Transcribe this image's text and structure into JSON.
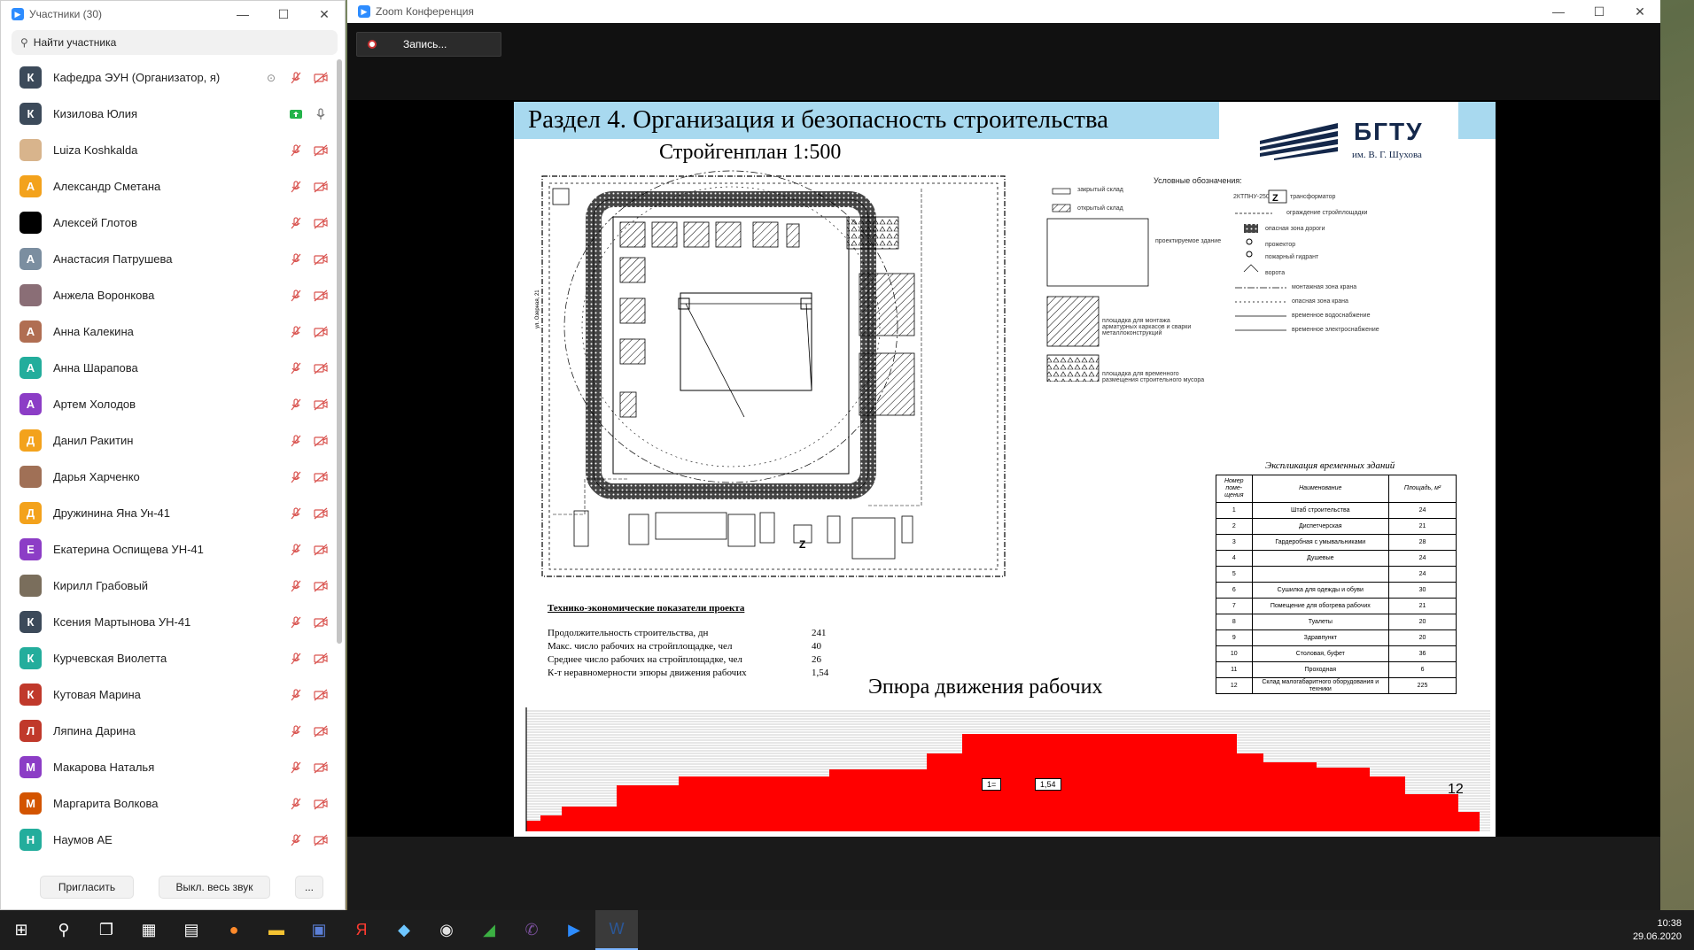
{
  "participants_window": {
    "title": "Участники (30)",
    "search_placeholder": "Найти участника",
    "participants": [
      {
        "name": "Кафедра ЭУН (Организатор, я)",
        "initial": "К",
        "color": "#3c4a5a",
        "host": true
      },
      {
        "name": "Кизилова Юлия",
        "initial": "К",
        "color": "#3c4a5a",
        "sharing": true
      },
      {
        "name": "Luiza Koshkalda",
        "initial": "",
        "color": "#d8b48c",
        "photo": true
      },
      {
        "name": "Александр Сметана",
        "initial": "А",
        "color": "#f3a21c"
      },
      {
        "name": "Алексей Глотов",
        "initial": "",
        "color": "#000000",
        "photo": true
      },
      {
        "name": "Анастасия Патрушева",
        "initial": "А",
        "color": "#7b8ea0"
      },
      {
        "name": "Анжела Воронкова",
        "initial": "",
        "color": "#8a6e76",
        "photo": true
      },
      {
        "name": "Анна Калекина",
        "initial": "А",
        "color": "#b06e52"
      },
      {
        "name": "Анна Шарапова",
        "initial": "А",
        "color": "#23ad9c"
      },
      {
        "name": "Артем Холодов",
        "initial": "А",
        "color": "#8c3dc6"
      },
      {
        "name": "Данил Ракитин",
        "initial": "Д",
        "color": "#f3a21c"
      },
      {
        "name": "Дарья Харченко",
        "initial": "",
        "color": "#a07056",
        "photo": true
      },
      {
        "name": "Дружинина Яна Ун-41",
        "initial": "Д",
        "color": "#f3a21c"
      },
      {
        "name": "Екатерина Оспищева УН-41",
        "initial": "Е",
        "color": "#8c3dc6"
      },
      {
        "name": "Кирилл Грабовый",
        "initial": "",
        "color": "#7a6e5c",
        "photo": true
      },
      {
        "name": "Ксения Мартынова УН-41",
        "initial": "К",
        "color": "#3c4a5a"
      },
      {
        "name": "Курчевская Виолетта",
        "initial": "К",
        "color": "#23ad9c"
      },
      {
        "name": "Кутовая Марина",
        "initial": "К",
        "color": "#c0392b"
      },
      {
        "name": "Ляпина Дарина",
        "initial": "Л",
        "color": "#c0392b"
      },
      {
        "name": "Макарова Наталья",
        "initial": "М",
        "color": "#8c3dc6"
      },
      {
        "name": "Маргарита Волкова",
        "initial": "М",
        "color": "#d35400"
      },
      {
        "name": "Наумов АЕ",
        "initial": "Н",
        "color": "#23ad9c"
      }
    ],
    "footer": {
      "invite": "Пригласить",
      "mute_all": "Выкл. весь звук",
      "more": "..."
    }
  },
  "zoom_window": {
    "title": "Zoom Конференция",
    "record_label": "Запись..."
  },
  "slide": {
    "header_title": "Раздел 4. Организация и безопасность строительства",
    "logo_main": "БГТУ",
    "logo_sub": "им. В. Г. Шухова",
    "plan_title": "Стройгенплан 1:500",
    "legend_title": "Условные обозначения:",
    "legend_items": {
      "closed_storage": "закрытый склад",
      "open_storage": "открытый склад",
      "designed_building": "проектируемое здание",
      "assembly_area": "площадка для монтажа арматурных каркасов и сварки металлоконструкций",
      "waste_area": "площадка для временного размещения строительного мусора",
      "transformer_label": "2КТПНУ-250",
      "transformer": "трансформатор",
      "fence": "ограждение стройплощадки",
      "danger_road": "опасная зона дороги",
      "projector": "прожектор",
      "hydrant": "пожарный гидрант",
      "gates": "ворота",
      "crane_mount": "монтажная зона крана",
      "crane_danger": "опасная зона крана",
      "temp_water": "временное водоснабжение",
      "temp_power": "временное электроснабжение"
    },
    "tep": {
      "title": "Технико-экономические показатели проекта",
      "rows": [
        {
          "label": "Продолжительность строительства, дн",
          "value": "241"
        },
        {
          "label": "Макс. число рабочих на стройплощадке, чел",
          "value": "40"
        },
        {
          "label": "Среднее число рабочих на стройплощадке, чел",
          "value": "26"
        },
        {
          "label": "К-т неравномерности эпюры движения рабочих",
          "value": "1,54"
        }
      ]
    },
    "explication": {
      "title": "Экспликация временных зданий",
      "headers": [
        "Номер поме-щения",
        "Наименование",
        "Площадь, м²"
      ],
      "rows": [
        [
          "1",
          "Штаб строительства",
          "24"
        ],
        [
          "2",
          "Диспетчерская",
          "21"
        ],
        [
          "3",
          "Гардеробная с умывальниками",
          "28"
        ],
        [
          "4",
          "Душевые",
          "24"
        ],
        [
          "5",
          "",
          "24"
        ],
        [
          "6",
          "Сушилка для одежды и обуви",
          "30"
        ],
        [
          "7",
          "Помещение для обогрева рабочих",
          "21"
        ],
        [
          "8",
          "Туалеты",
          "20"
        ],
        [
          "9",
          "Здравпункт",
          "20"
        ],
        [
          "10",
          "Столовая, буфет",
          "36"
        ],
        [
          "11",
          "Проходная",
          "6"
        ],
        [
          "12",
          "Склад малогабаритного оборудования и техники",
          "225"
        ]
      ]
    },
    "epure_title": "Эпюра движения рабочих",
    "epure_label_a": "1=",
    "epure_label_b": "1,54",
    "epure_end": "12",
    "road_label": "ул. Озерная, 21"
  },
  "taskbar": {
    "time": "10:38",
    "date": "29.06.2020"
  }
}
